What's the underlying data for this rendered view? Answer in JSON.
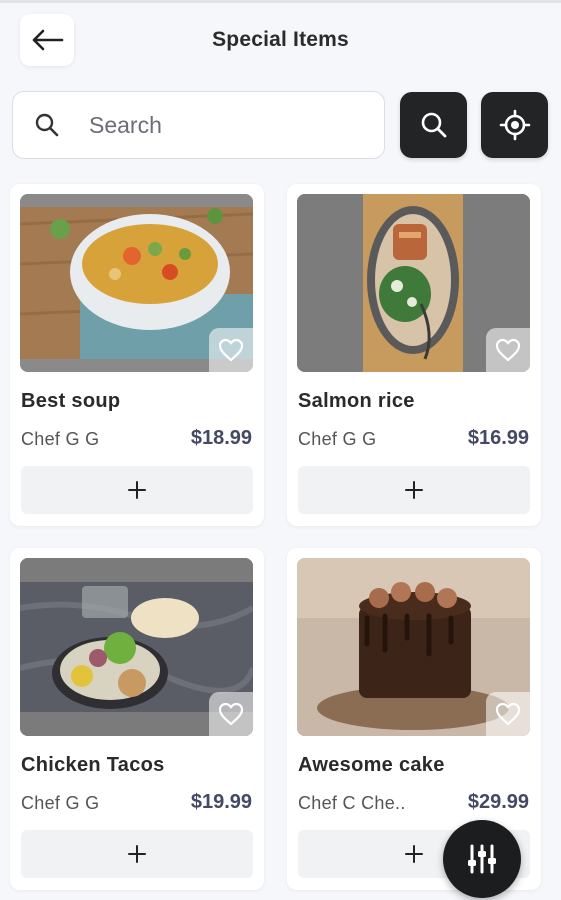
{
  "header": {
    "title": "Special Items",
    "back_icon": "arrow-left-icon"
  },
  "search": {
    "placeholder": "Search",
    "value": ""
  },
  "toolbar": {
    "search_button_icon": "search-icon",
    "locate_button_icon": "locate-icon"
  },
  "items": [
    {
      "name": "Best soup",
      "chef": "Chef G G",
      "price": "$18.99",
      "image": "soup-bowl",
      "favorite": false
    },
    {
      "name": "Salmon rice",
      "chef": "Chef G G",
      "price": "$16.99",
      "image": "salmon-plate",
      "favorite": false
    },
    {
      "name": "Chicken Tacos",
      "chef": "Chef G G",
      "price": "$19.99",
      "image": "tacos-plate",
      "favorite": false
    },
    {
      "name": "Awesome cake",
      "chef": "Chef C Che..",
      "price": "$29.99",
      "image": "chocolate-cake",
      "favorite": false
    }
  ],
  "add_label": "+",
  "fab": {
    "icon": "filter-sliders-icon"
  },
  "colors": {
    "dark_button": "#232425",
    "price": "#444a63",
    "background": "#f6f7fb"
  }
}
